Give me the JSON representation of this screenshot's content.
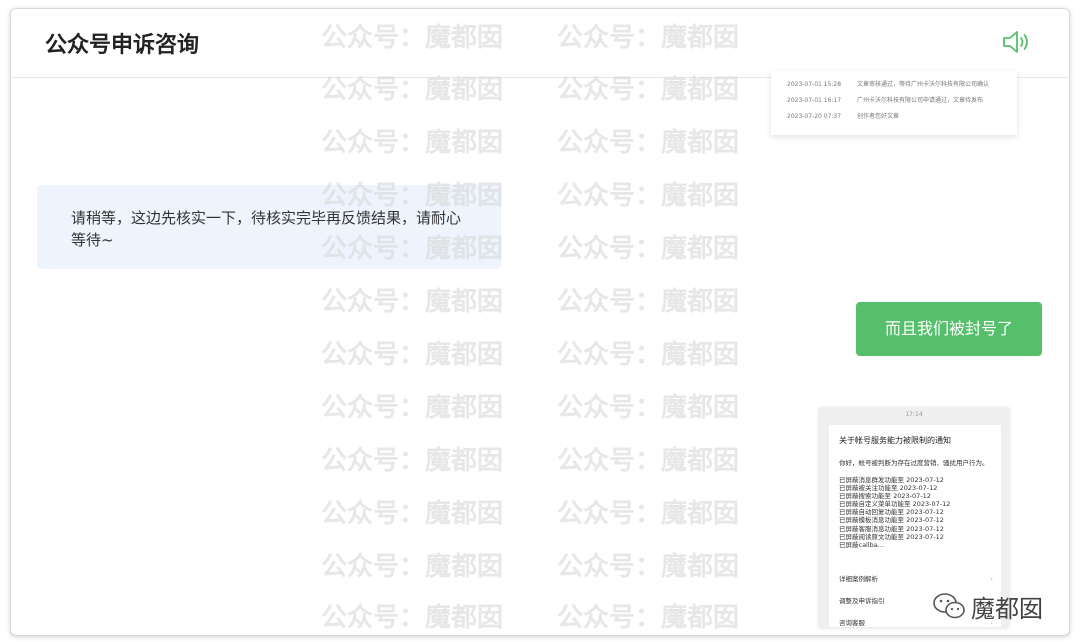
{
  "header": {
    "title": "公众号申诉咨询",
    "speaker_icon": "speaker-icon",
    "accent_color": "#55bf6c"
  },
  "top_screenshot": {
    "rows": [
      {
        "date": "2023-07-01 15:28",
        "text": "文章审核通过，等待广州卡沃尔科技有限公司确认"
      },
      {
        "date": "2023-07-01 16:17",
        "text": "广州卡沃尔科技有限公司申请通过，文章待发布"
      },
      {
        "date": "2023-07-20 07:37",
        "text": "创作者您好文章"
      }
    ]
  },
  "messages": {
    "service": "请稍等，这边先核实一下，待核实完毕再反馈结果，请耐心等待~",
    "user": "而且我们被封号了"
  },
  "notice_screenshot": {
    "time": "17:14",
    "title": "关于帐号服务能力被限制的通知",
    "intro": "你好，帐号被判断为存在过度营销、骚扰用户行为。",
    "lines": [
      "已屏蔽消息群发功能至 2023-07-12",
      "已屏蔽被关注功能至 2023-07-12",
      "已屏蔽搜索功能至 2023-07-12",
      "已屏蔽自定义菜单功能至 2023-07-12",
      "已屏蔽自动回复功能至 2023-07-12",
      "已屏蔽模板消息功能至 2023-07-12",
      "已屏蔽客服消息功能至 2023-07-12",
      "已屏蔽阅读原文功能至 2023-07-12",
      "已屏蔽callba..."
    ],
    "menu": [
      "详细案例解析",
      "调整及申诉指引",
      "咨询客服"
    ]
  },
  "watermark": {
    "text": "公众号：魔都囡",
    "logo_text": "魔都囡"
  }
}
